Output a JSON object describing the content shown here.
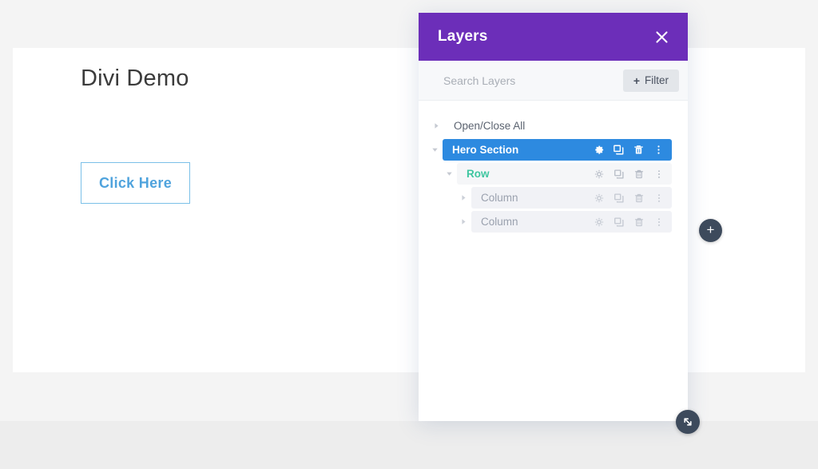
{
  "page": {
    "title": "Divi Demo",
    "cta_label": "Click Here"
  },
  "canvas": {
    "add_module_label": "+"
  },
  "panel": {
    "header": {
      "title": "Layers",
      "close_icon": "close-icon"
    },
    "search": {
      "placeholder": "Search Layers",
      "value": ""
    },
    "filter": {
      "plus": "+",
      "label": "Filter"
    },
    "tree": [
      {
        "label": "Open/Close All",
        "type": "open-close-all",
        "expanded": false,
        "has_actions": false
      },
      {
        "label": "Hero Section",
        "type": "section",
        "expanded": true,
        "selected": true,
        "has_actions": true
      },
      {
        "label": "Row",
        "type": "row",
        "expanded": true,
        "has_actions": true
      },
      {
        "label": "Column",
        "type": "column",
        "expanded": false,
        "has_actions": true
      },
      {
        "label": "Column",
        "type": "column",
        "expanded": false,
        "has_actions": true
      }
    ],
    "row_action_icons": [
      "gear-icon",
      "duplicate-icon",
      "trash-icon",
      "more-vertical-icon"
    ],
    "resize_handle_icon": "resize-diagonal-icon"
  },
  "colors": {
    "panel_header": "#6c2eb9",
    "section_row": "#2d8ae0",
    "row_label": "#3ec6a0",
    "column_label": "#9aa1ae",
    "cta_border": "#7bc0e8",
    "cta_text": "#4fa3dd",
    "fab": "#3d4a5c",
    "page_bg": "#f4f4f4",
    "card_bg": "#ffffff"
  }
}
